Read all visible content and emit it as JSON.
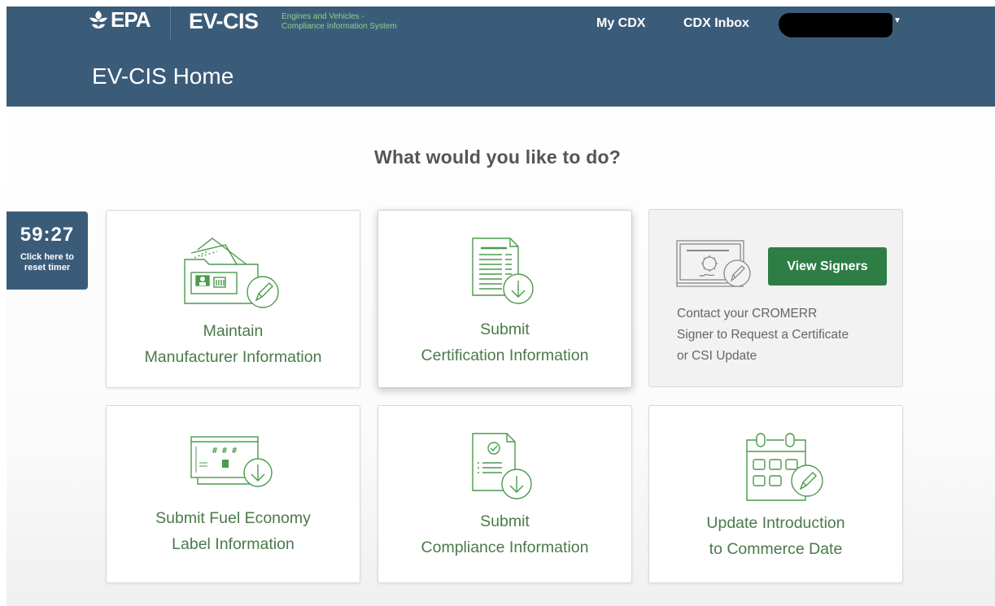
{
  "header": {
    "agency_logo": "EPA",
    "app_abbr": "EV-CIS",
    "app_full_line1": "Engines and Vehicles -",
    "app_full_line2": "Compliance Information System",
    "nav": {
      "my_cdx": "My CDX",
      "cdx_inbox": "CDX Inbox"
    }
  },
  "page_title": "EV-CIS Home",
  "question": "What would you like to do?",
  "timer": {
    "value": "59:27",
    "hint_line1": "Click here to",
    "hint_line2": "reset timer"
  },
  "cards": [
    {
      "line1": "Maintain",
      "line2": "Manufacturer Information"
    },
    {
      "line1": "Submit",
      "line2": "Certification Information"
    },
    {
      "button": "View Signers",
      "line1": "Contact your CROMERR",
      "line2": "Signer to Request a Certificate",
      "line3": "or CSI Update"
    },
    {
      "line1": "Submit Fuel Economy",
      "line2": "Label Information"
    },
    {
      "line1": "Submit",
      "line2": "Compliance Information"
    },
    {
      "line1": "Update Introduction",
      "line2": "to Commerce Date"
    }
  ],
  "colors": {
    "header_bg": "#3b5c79",
    "accent_green": "#2e7d45",
    "icon_green": "#4c9a4c",
    "label_green": "#4a7a4a"
  },
  "icons": [
    "folder-pencil-icon",
    "document-download-icon",
    "certificate-pencil-icon",
    "fuel-label-download-icon",
    "compliance-document-download-icon",
    "calendar-pencil-icon"
  ]
}
